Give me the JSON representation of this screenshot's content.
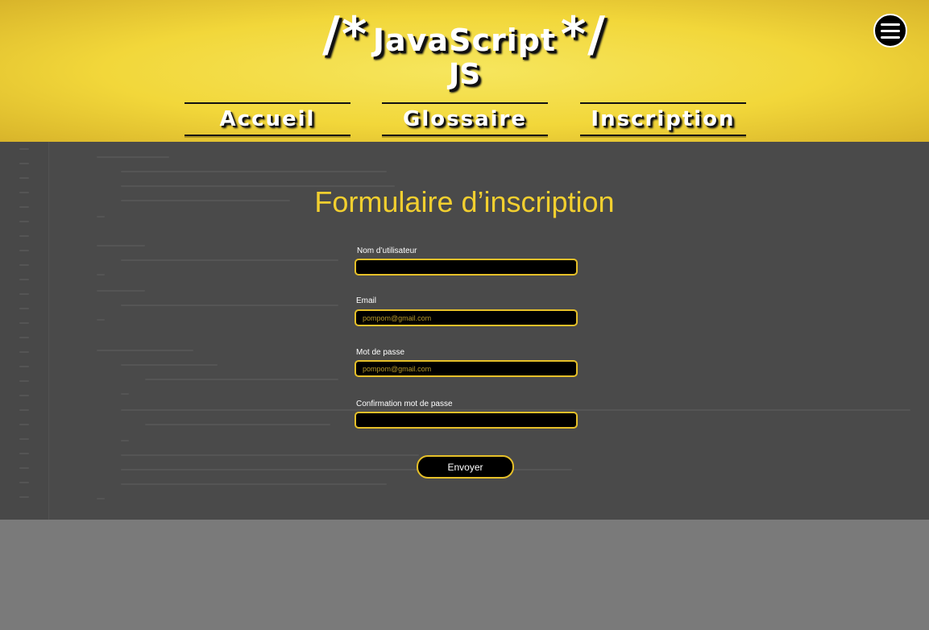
{
  "header": {
    "title_open": "/*",
    "title_word": "JavaScript",
    "title_close": "*/",
    "subtitle": "JS",
    "menu_icon": "hamburger-menu-icon"
  },
  "nav": {
    "items": [
      {
        "label": "Accueil"
      },
      {
        "label": "Glossaire"
      },
      {
        "label": "Inscription"
      }
    ]
  },
  "form": {
    "title": "Formulaire d’inscription",
    "fields": [
      {
        "label": "Nom d’utilisateur",
        "placeholder": "",
        "value": ""
      },
      {
        "label": "Email",
        "placeholder": "pompom@gmail.com",
        "value": ""
      },
      {
        "label": "Mot de passe",
        "placeholder": "pompom@gmail.com",
        "value": ""
      },
      {
        "label": "Confirmation mot de passe",
        "placeholder": "",
        "value": ""
      }
    ],
    "submit_label": "Envoyer"
  },
  "colors": {
    "accent": "#f2cf2f",
    "header_bg": "#f2d73a",
    "main_bg": "#4a4a4a",
    "input_bg": "#000000"
  }
}
